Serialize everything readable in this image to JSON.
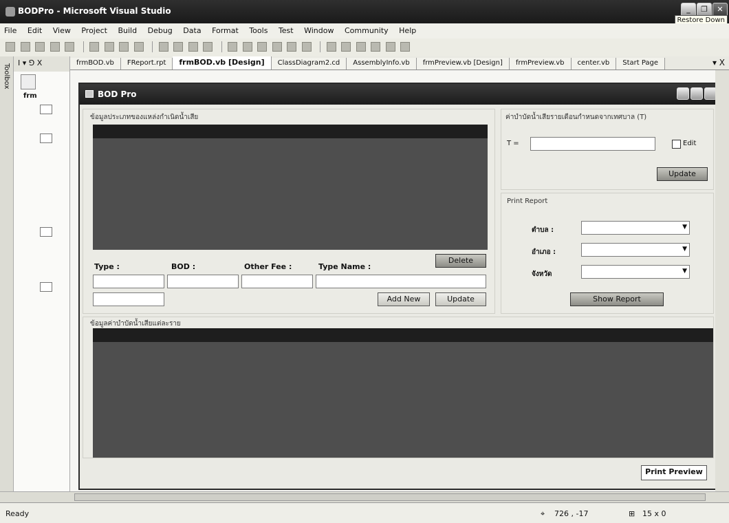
{
  "window": {
    "title": "BODPro - Microsoft Visual Studio",
    "tooltip": "Restore Down"
  },
  "menu": [
    "File",
    "Edit",
    "View",
    "Project",
    "Build",
    "Debug",
    "Data",
    "Format",
    "Tools",
    "Test",
    "Window",
    "Community",
    "Help"
  ],
  "tree_panel": {
    "header": "Ӏ ▾ ⅁ X",
    "root_label": "frm"
  },
  "toolbox_label": "Toolbox",
  "tabs": [
    {
      "label": "frmBOD.vb"
    },
    {
      "label": "FReport.rpt"
    },
    {
      "label": "frmBOD.vb [Design]",
      "active": true
    },
    {
      "label": "ClassDiagram2.cd"
    },
    {
      "label": "AssemblyInfo.vb"
    },
    {
      "label": "frmPreview.vb [Design]"
    },
    {
      "label": "frmPreview.vb"
    },
    {
      "label": "center.vb"
    },
    {
      "label": "Start Page"
    }
  ],
  "tab_close": "▾ X",
  "form": {
    "title": "BOD Pro",
    "group_types": "ข้อมูลประเภทของแหล่งกำเนิดน้ำเสีย",
    "group_t": "ค่าบำบัดน้ำเสียรายเดือนกำหนดจากเทศบาล (T)",
    "t_label": "T =",
    "edit_label": "Edit",
    "update_t": "Update",
    "group_print": "Print Report",
    "tambon_label": "ตำบล :",
    "amphoe_label": "อำเภอ :",
    "province_label": "จังหวัด",
    "show_report": "Show Report",
    "delete_btn": "Delete",
    "type_label": "Type :",
    "bod_label": "BOD :",
    "other_fee_label": "Other Fee :",
    "type_name_label": "Type Name :",
    "add_new_btn": "Add New",
    "update_btn": "Update",
    "group_fees": "ข้อมูลค่าบำบัดน้ำเสียแต่ละราย",
    "print_preview": "Print Preview"
  },
  "status": {
    "ready": "Ready",
    "position": "726 , -17",
    "size": "15 x 0"
  }
}
